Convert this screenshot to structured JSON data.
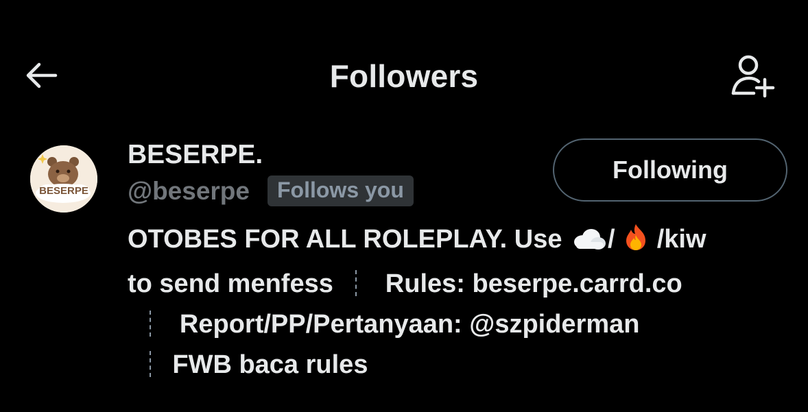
{
  "header": {
    "title": "Followers",
    "back_icon": "arrow-left-icon",
    "add_icon": "person-plus-icon"
  },
  "user": {
    "name": "BESERPE.",
    "handle": "@beserpe",
    "follows_you": "Follows you",
    "follow_button": "Following",
    "avatar_text": "BESERPE",
    "bio": {
      "line1_text": "OTOBES FOR ALL ROLEPLAY. Use",
      "line1_slash1": "/",
      "line1_tail": "/kiw",
      "line2_text": "to send menfess",
      "line2_rules": "Rules: beserpe.carrd.co",
      "line3_text": "Report/PP/Pertanyaan: @szpiderman",
      "line4_text": "FWB baca rules",
      "emoji_1": "cloud-emoji",
      "emoji_2": "fire-emoji"
    }
  },
  "colors": {
    "background": "#000000",
    "text": "#e7e9ea",
    "secondary_text": "#71767b",
    "badge_bg": "#2f3336",
    "button_border": "#536471"
  }
}
